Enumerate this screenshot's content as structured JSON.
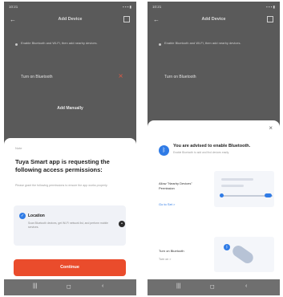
{
  "left": {
    "status_time": "10:21",
    "status_icons": "▪ ▪ ▪ ▮",
    "title": "Add Device",
    "hint": "Enable Bluetooth and Wi-Fi, then add nearby devices.",
    "bt_row_label": "Turn on Bluetooth",
    "add_manually": "Add Manually",
    "sheet_caption": "Note",
    "sheet_title": "Tuya Smart app is requesting the following access permissions:",
    "sheet_subtitle": "Please grant the following permissions to ensure the app works properly.",
    "permission_name": "Location",
    "permission_desc": "Scan Bluetooth devices, get Wi-Fi network list, and perform mobile services.",
    "confirm_label": "Continue"
  },
  "right": {
    "status_time": "10:21",
    "status_icons": "▪ ▪ ▪ ▮",
    "title": "Add Device",
    "hint": "Enable Bluetooth and Wi-Fi, then add nearby devices.",
    "bt_row_label": "Turn on Bluetooth",
    "close": "×",
    "sheet_title": "You are advised to enable Bluetooth.",
    "sheet_subtitle": "Enable Bluetooth to add and find devices easily.",
    "nearby_label": "Allow \"Nearby Devices\" Permission",
    "nearby_link": "Go to Set >",
    "bt_label": "Turn on Bluetooth",
    "bt_link": "Turn on >"
  },
  "navbar": {
    "recent": "|||",
    "home": "◻",
    "back": "‹"
  },
  "icons": {
    "back": "arrow-left-icon",
    "scan": "scan-icon",
    "bluetooth": "bluetooth-icon",
    "check": "check-icon",
    "more": "more-icon",
    "close": "close-icon"
  },
  "colors": {
    "accent": "#ea4c2c",
    "primary_blue": "#2f7be6"
  }
}
